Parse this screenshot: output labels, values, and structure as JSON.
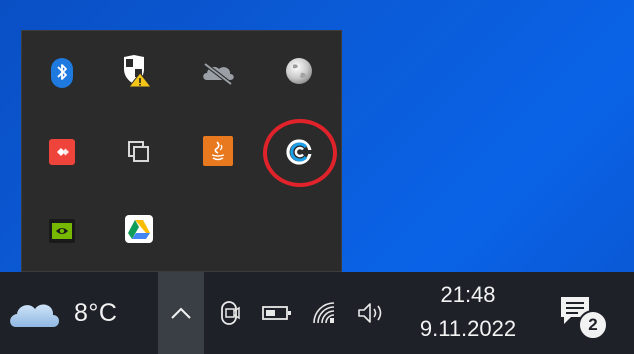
{
  "flyout": {
    "items": [
      {
        "name": "bluetooth-icon"
      },
      {
        "name": "windows-security-warning-icon"
      },
      {
        "name": "onedrive-offline-icon"
      },
      {
        "name": "globe-icon"
      },
      {
        "name": "anydesk-icon"
      },
      {
        "name": "copy-windows-icon"
      },
      {
        "name": "java-update-icon"
      },
      {
        "name": "ccleaner-icon"
      },
      {
        "name": "nvidia-icon"
      },
      {
        "name": "google-drive-icon"
      }
    ]
  },
  "taskbar": {
    "weather": {
      "temperature": "8°C"
    },
    "clock": {
      "time": "21:48",
      "date": "9.11.2022"
    },
    "notifications": {
      "count": "2"
    }
  },
  "colors": {
    "desktop": "#0a5ad6",
    "taskbar": "#1e2228",
    "flyout": "#2b2b2b",
    "highlight": "#e0232a"
  }
}
